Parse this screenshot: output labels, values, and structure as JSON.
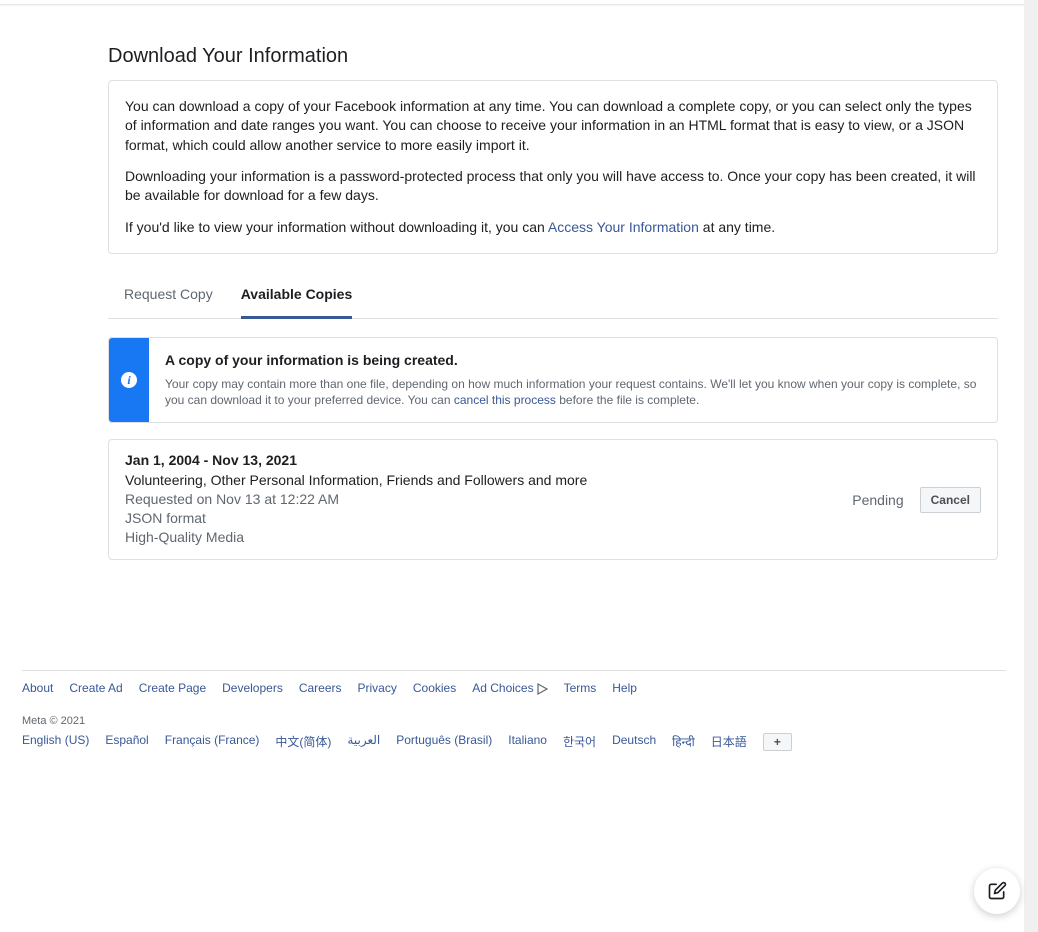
{
  "page_title": "Download Your Information",
  "intro": {
    "p1": "You can download a copy of your Facebook information at any time. You can download a complete copy, or you can select only the types of information and date ranges you want. You can choose to receive your information in an HTML format that is easy to view, or a JSON format, which could allow another service to more easily import it.",
    "p2": "Downloading your information is a password-protected process that only you will have access to. Once your copy has been created, it will be available for download for a few days.",
    "p3_before": "If you'd like to view your information without downloading it, you can ",
    "p3_link": "Access Your Information",
    "p3_after": " at any time."
  },
  "tabs": {
    "request": "Request Copy",
    "available": "Available Copies"
  },
  "banner": {
    "title": "A copy of your information is being created.",
    "msg_before": "Your copy may contain more than one file, depending on how much information your request contains. We'll let you know when your copy is complete, so you can download it to your preferred device. You can ",
    "msg_link": "cancel this process",
    "msg_after": " before the file is complete."
  },
  "copy": {
    "date_range": "Jan 1, 2004 - Nov 13, 2021",
    "categories": "Volunteering, Other Personal Information, Friends and Followers and more",
    "requested": "Requested on Nov 13 at 12:22 AM",
    "format": "JSON format",
    "media": "High-Quality Media",
    "status": "Pending",
    "cancel_label": "Cancel"
  },
  "footer": {
    "links": [
      "About",
      "Create Ad",
      "Create Page",
      "Developers",
      "Careers",
      "Privacy",
      "Cookies",
      "Ad Choices",
      "Terms",
      "Help"
    ],
    "copyright": "Meta © 2021",
    "languages": [
      "English (US)",
      "Español",
      "Français (France)",
      "中文(简体)",
      "العربية",
      "Português (Brasil)",
      "Italiano",
      "한국어",
      "Deutsch",
      "हिन्दी",
      "日本語"
    ],
    "more_label": "+"
  }
}
